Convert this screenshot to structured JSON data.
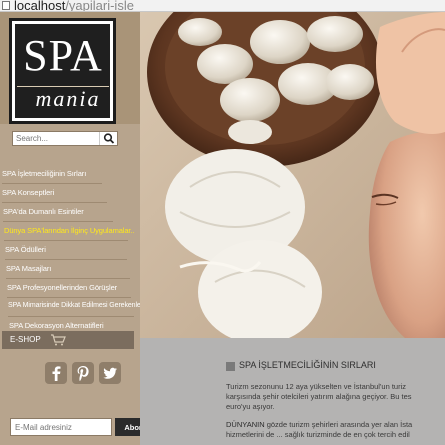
{
  "browser": {
    "url_host": "localhost",
    "url_path": "/yapilari-isle"
  },
  "logo": {
    "line1": "SPA",
    "line2": "mania"
  },
  "search": {
    "placeholder": "Search..."
  },
  "nav": {
    "items": [
      {
        "label": "SPA İşletmeciliğinin Sırları"
      },
      {
        "label": "SPA Konseptleri"
      },
      {
        "label": "SPA'da Dumanlı Esintiler"
      },
      {
        "label": "Dünya SPA'larından İlginç Uygulamalar..",
        "highlighted": true
      },
      {
        "label": "SPA Ödülleri"
      },
      {
        "label": "SPA Masajları"
      },
      {
        "label": "SPA Profesyonellerinden Görüşler"
      },
      {
        "label": "SPA Mimarisinde Dikkat Edilmesi Gerekenler"
      },
      {
        "label": "SPA Dekorasyon Alternatifleri"
      }
    ],
    "eshop_label": "E-SHOP"
  },
  "social": {
    "icons": [
      "facebook-icon",
      "pinterest-icon",
      "twitter-icon"
    ]
  },
  "newsletter": {
    "placeholder": "E-Mail adresiniz",
    "button_label": "Abone Ol"
  },
  "article": {
    "title": "SPA İŞLETMECİLİĞİNİN SIRLARI",
    "para1_line1": "Turizm sezonunu 12 aya yükselten ve İstanbul'un turiz",
    "para1_line2": "karşısında şehir otelcileri yatırım alağına geçiyor. Bu tes",
    "para1_line3": "euro'yu aşıyor.",
    "para2_lead": "DÜNYANIN",
    "para2_line1_rest": "gözde turizm şehirleri arasında yer alan İsta",
    "para2_line2": "hizmetlerini de ... sağlık turizminde de en çok tercih edil"
  },
  "colors": {
    "sidebar": "#b7a48d",
    "highlight": "#ffe81a",
    "content_bg": "#b4b3b2",
    "button_dark": "#2b2b2b"
  }
}
